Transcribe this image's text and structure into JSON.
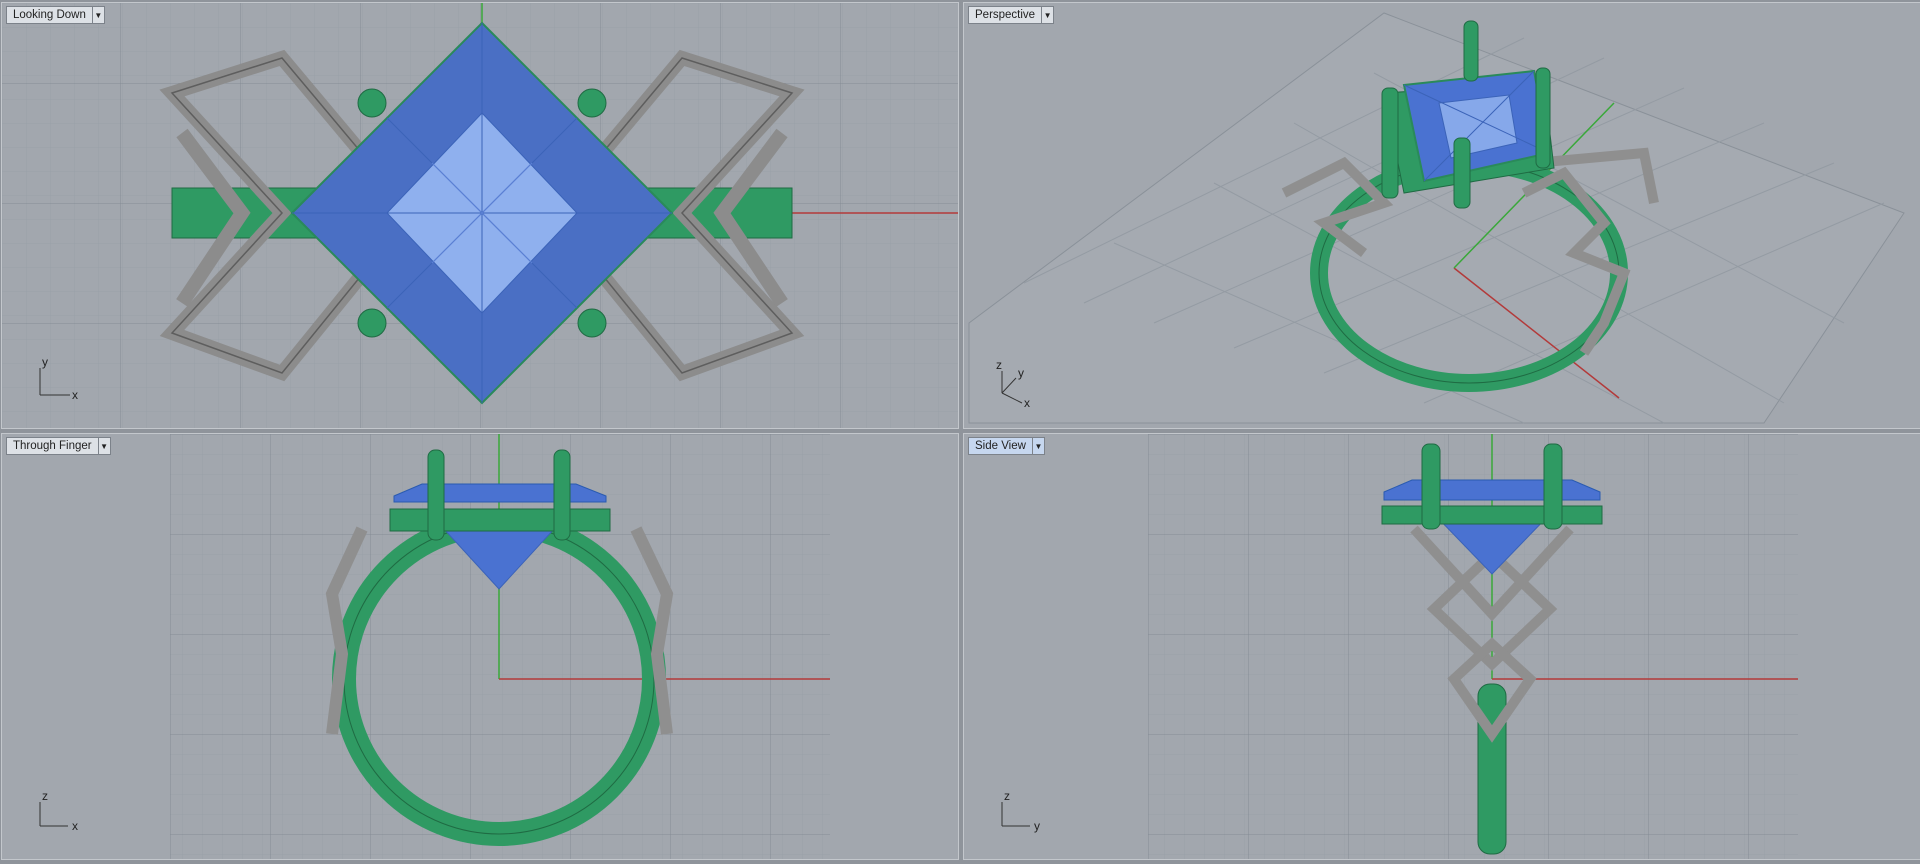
{
  "viewports": [
    {
      "title": "Looking Down",
      "axes": {
        "vertical": "y",
        "horizontal": "x"
      }
    },
    {
      "title": "Perspective",
      "axes": {
        "vertical": "z",
        "depth": "y",
        "horizontal": "x"
      }
    },
    {
      "title": "Through Finger",
      "axes": {
        "vertical": "z",
        "horizontal": "x"
      }
    },
    {
      "title": "Side View",
      "axes": {
        "vertical": "z",
        "horizontal": "y"
      }
    }
  ],
  "colors": {
    "viewport_bg": "#a2a7ae",
    "grid_minor": "#98a0a8",
    "grid_major": "#828992",
    "x_axis": "#b33a3a",
    "y_axis": "#3aa83a",
    "gem": "#5b82d9",
    "metal_green": "#2f9a63",
    "metal_gray": "#9a9a9a",
    "active_tab": "#c6d7ef"
  },
  "icons": {
    "viewport_menu": "dropdown-arrow-icon"
  }
}
